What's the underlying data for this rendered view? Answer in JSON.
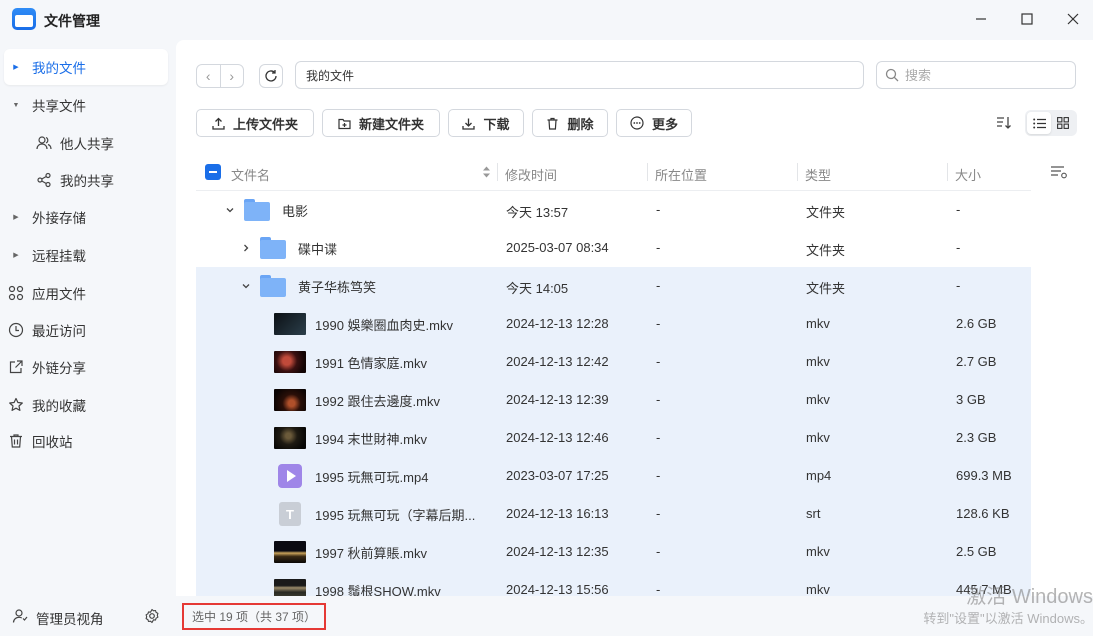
{
  "app": {
    "title": "文件管理"
  },
  "sidebar": {
    "items": [
      {
        "label": "我的文件"
      },
      {
        "label": "共享文件"
      },
      {
        "label": "他人共享"
      },
      {
        "label": "我的共享"
      },
      {
        "label": "外接存储"
      },
      {
        "label": "远程挂载"
      },
      {
        "label": "应用文件"
      },
      {
        "label": "最近访问"
      },
      {
        "label": "外链分享"
      },
      {
        "label": "我的收藏"
      },
      {
        "label": "回收站"
      }
    ],
    "footer_label": "管理员视角"
  },
  "path": {
    "current": "我的文件"
  },
  "search": {
    "placeholder": "搜索"
  },
  "toolbar": {
    "upload_folder": "上传文件夹",
    "new_folder": "新建文件夹",
    "download": "下载",
    "delete": "删除",
    "more": "更多"
  },
  "table": {
    "columns": [
      "文件名",
      "修改时间",
      "所在位置",
      "类型",
      "大小"
    ],
    "rows": [
      {
        "name": "电影",
        "modified": "今天 13:57",
        "location": "-",
        "type": "文件夹",
        "size": "-",
        "kind": "folder",
        "expanded": true,
        "selected": false
      },
      {
        "name": "碟中谍",
        "modified": "2025-03-07 08:34",
        "location": "-",
        "type": "文件夹",
        "size": "-",
        "kind": "folder",
        "expanded": false,
        "selected": false
      },
      {
        "name": "黄子华栋笃笑",
        "modified": "今天 14:05",
        "location": "-",
        "type": "文件夹",
        "size": "-",
        "kind": "folder",
        "expanded": true,
        "selected": true
      },
      {
        "name": "1990 娛樂圈血肉史.mkv",
        "modified": "2024-12-13 12:28",
        "location": "-",
        "type": "mkv",
        "size": "2.6 GB",
        "kind": "video",
        "selected": true
      },
      {
        "name": "1991 色情家庭.mkv",
        "modified": "2024-12-13 12:42",
        "location": "-",
        "type": "mkv",
        "size": "2.7 GB",
        "kind": "video",
        "selected": true
      },
      {
        "name": "1992 跟住去邊度.mkv",
        "modified": "2024-12-13 12:39",
        "location": "-",
        "type": "mkv",
        "size": "3 GB",
        "kind": "video",
        "selected": true
      },
      {
        "name": "1994 末世財神.mkv",
        "modified": "2024-12-13 12:46",
        "location": "-",
        "type": "mkv",
        "size": "2.3 GB",
        "kind": "video",
        "selected": true
      },
      {
        "name": "1995 玩無可玩.mp4",
        "modified": "2023-03-07 17:25",
        "location": "-",
        "type": "mp4",
        "size": "699.3 MB",
        "kind": "mp4",
        "selected": true
      },
      {
        "name": "1995 玩無可玩（字幕后期...",
        "modified": "2024-12-13 16:13",
        "location": "-",
        "type": "srt",
        "size": "128.6 KB",
        "kind": "srt",
        "selected": true
      },
      {
        "name": "1997 秋前算賬.mkv",
        "modified": "2024-12-13 12:35",
        "location": "-",
        "type": "mkv",
        "size": "2.5 GB",
        "kind": "video",
        "selected": true
      },
      {
        "name": "1998 鬚根SHOW.mkv",
        "modified": "2024-12-13 15:56",
        "location": "-",
        "type": "mkv",
        "size": "445.7 MB",
        "kind": "video",
        "selected": true
      }
    ]
  },
  "status": {
    "selection": "选中 19 项（共 37 项）"
  },
  "watermark": {
    "line1": "激活 Windows",
    "line2": "转到\"设置\"以激活 Windows。"
  },
  "colors": {
    "accent": "#1a6ee8",
    "selected_row": "#eaf1fb",
    "highlight_box": "#e53935"
  }
}
